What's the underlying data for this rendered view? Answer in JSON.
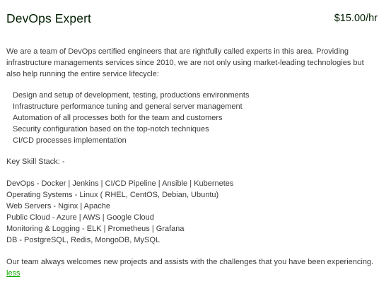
{
  "header": {
    "title": "DevOps Expert",
    "rate": "$15.00/hr"
  },
  "description": {
    "intro": "We are a team of DevOps certified engineers that are rightfully called experts in this area. Providing infrastructure managements services since 2010, we are not only using market-leading technologies but also help running the entire service lifecycle:",
    "bullets": [
      "Design and setup of development, testing, productions environments",
      "Infrastructure performance tuning and general server management",
      "Automation of all processes both for the team and customers",
      "Security configuration based on the top-notch techniques",
      "CI/CD processes implementation"
    ],
    "skills_heading": "Key Skill Stack: -",
    "skills": [
      "DevOps - Docker | Jenkins | CI/CD Pipeline | Ansible | Kubernetes",
      "Operating Systems - Linux ( RHEL, CentOS, Debian, Ubuntu)",
      "Web Servers - Nginx | Apache",
      "Public Cloud - Azure | AWS | Google Cloud",
      "Monitoring & Logging - ELK | Prometheus | Grafana",
      "DB - PostgreSQL, Redis, MongoDB, MySQL"
    ],
    "outro": "Our team always welcomes new projects and assists with the challenges that you have been experiencing.",
    "toggle_label": "less"
  },
  "colors": {
    "title": "#001e00",
    "body_text": "#3a3a3a",
    "link": "#14a800"
  }
}
